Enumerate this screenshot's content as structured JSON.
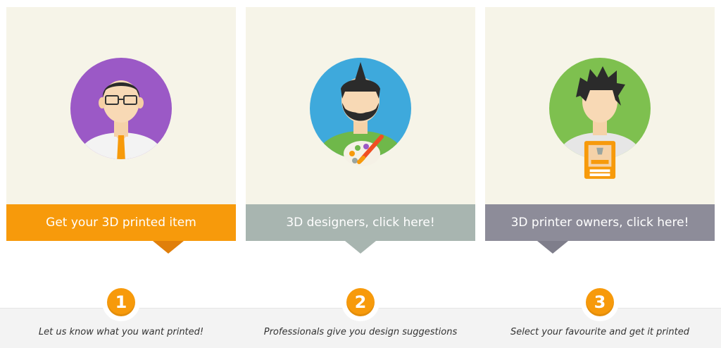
{
  "cards": [
    {
      "banner_label": "Get your 3D printed item",
      "banner_color": "#f79a0b",
      "pointer_color": "#e07f0b",
      "avatar": {
        "bg": "#9b59c6",
        "icon": "customer-avatar-icon"
      }
    },
    {
      "banner_label": "3D designers, click here!",
      "banner_color": "#a8b5b0",
      "pointer_color": "#a8b5b0",
      "avatar": {
        "bg": "#3ea9dc",
        "icon": "designer-avatar-icon"
      }
    },
    {
      "banner_label": "3D printer owners, click here!",
      "banner_color": "#8d8c99",
      "pointer_color": "#7f7e8b",
      "avatar": {
        "bg": "#7ec04f",
        "icon": "printer-owner-avatar-icon"
      }
    }
  ],
  "steps": [
    {
      "number": "1",
      "caption": "Let us know what you want printed!"
    },
    {
      "number": "2",
      "caption": "Professionals give you design suggestions"
    },
    {
      "number": "3",
      "caption": "Select your favourite and get it printed"
    }
  ],
  "colors": {
    "card_bg": "#f6f4e8",
    "accent": "#f79a0b",
    "strip_bg": "#f3f3f3"
  }
}
